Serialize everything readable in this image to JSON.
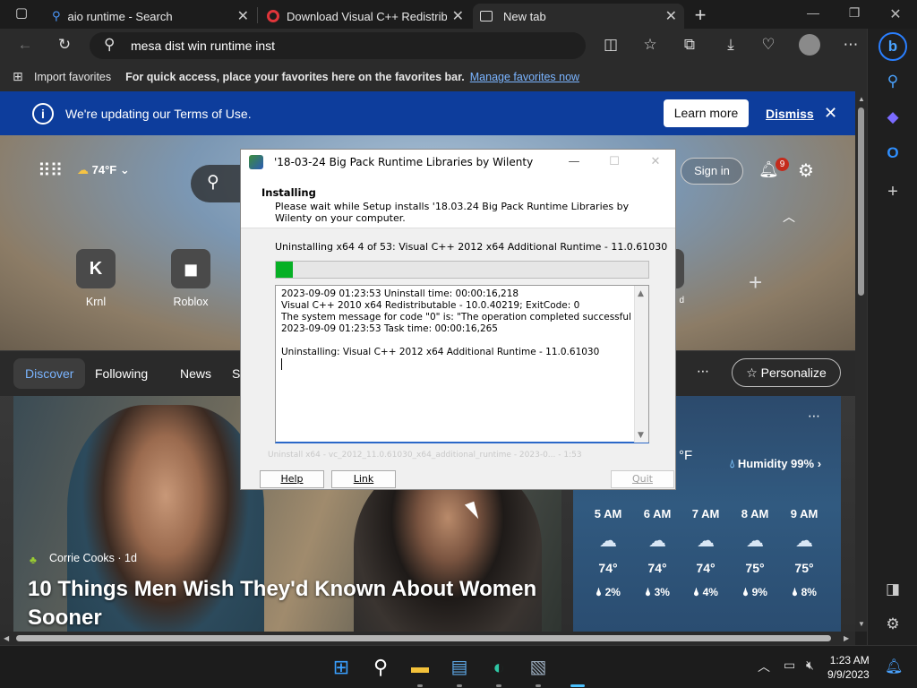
{
  "browser": {
    "tabs": [
      {
        "title": "aio runtime - Search",
        "icon": "search-icon"
      },
      {
        "title": "Download Visual C++ Redistribu",
        "icon": "opera-red-icon"
      },
      {
        "title": "New tab",
        "icon": "newtab-icon"
      }
    ],
    "address": "mesa dist win runtime inst",
    "favorites_bar": {
      "import": "Import favorites",
      "hint": "For quick access, place your favorites here on the favorites bar.",
      "manage": "Manage favorites now"
    }
  },
  "notice": {
    "message": "We're updating our Terms of Use.",
    "learn_more": "Learn more",
    "dismiss": "Dismiss"
  },
  "newtab": {
    "weather_temp": "74°F",
    "sign_in": "Sign in",
    "notifications": "9",
    "quick_links": [
      {
        "label": "Krnl",
        "glyph": "K"
      },
      {
        "label": "Roblox",
        "glyph": "◼"
      }
    ],
    "partial_link_label": "d",
    "feed_tabs": [
      "Discover",
      "Following",
      "News",
      "S"
    ],
    "personalize": "Personalize",
    "news": {
      "source": "Corrie Cooks · 1d",
      "headline": "10 Things Men Wish They'd Known About Women Sooner"
    },
    "weather": {
      "temp_partial": "°F",
      "humidity": "Humidity 99%",
      "hours": [
        {
          "time": "5 AM",
          "temp": "74°",
          "rain": "2%"
        },
        {
          "time": "6 AM",
          "temp": "74°",
          "rain": "3%"
        },
        {
          "time": "7 AM",
          "temp": "74°",
          "rain": "4%"
        },
        {
          "time": "8 AM",
          "temp": "75°",
          "rain": "9%"
        },
        {
          "time": "9 AM",
          "temp": "75°",
          "rain": "8%"
        }
      ]
    }
  },
  "installer": {
    "title": "'18-03-24 Big Pack Runtime Libraries by Wilenty",
    "heading": "Installing",
    "subtext": "Please wait while Setup installs '18.03.24 Big Pack Runtime Libraries by Wilenty on your computer.",
    "status": "Uninstalling x64 4 of 53:  Visual C++ 2012 x64 Additional Runtime - 11.0.61030",
    "progress": 0.045,
    "log": [
      "2023-09-09 01:23:53 Uninstall time: 00:00:16,218",
      " Visual C++ 2010  x64 Redistributable - 10.0.40219; ExitCode: 0",
      "The system message for code \"0\" is: \"The operation completed successfully\"",
      "2023-09-09 01:23:53 Task time: 00:00:16,265",
      "",
      "Uninstalling:  Visual C++ 2012 x64 Additional Runtime - 11.0.61030"
    ],
    "faint_line": "Uninstall x64 - vc_2012_11.0.61030_x64_additional_runtime - 2023-0... - 1:53",
    "buttons": {
      "help": "Help",
      "link": "Link",
      "quit": "Quit"
    }
  },
  "taskbar": {
    "time": "1:23 AM",
    "date": "9/9/2023"
  }
}
